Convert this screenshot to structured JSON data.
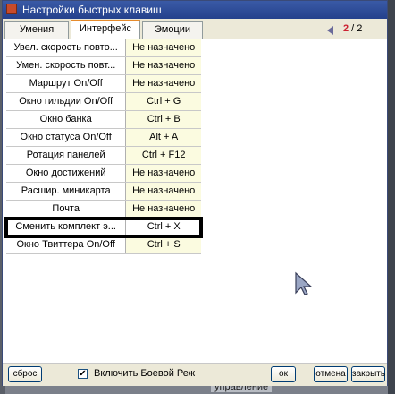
{
  "window": {
    "title": "Настройки быстрых клавиш"
  },
  "tabs": [
    {
      "label": "Умения",
      "active": false
    },
    {
      "label": "Интерфейс",
      "active": true
    },
    {
      "label": "Эмоции",
      "active": false
    }
  ],
  "pager": {
    "current": "2",
    "separator": " / ",
    "total": "2"
  },
  "rows": [
    {
      "name": "Увел. скорость повто...",
      "key": "Не назначено"
    },
    {
      "name": "Умен. скорость повт...",
      "key": "Не назначено"
    },
    {
      "name": "Маршрут On/Off",
      "key": "Не назначено"
    },
    {
      "name": "Окно гильдии On/Off",
      "key": "Ctrl + G"
    },
    {
      "name": "Окно банка",
      "key": "Ctrl + B"
    },
    {
      "name": "Окно статуса On/Off",
      "key": "Alt + A"
    },
    {
      "name": "Ротация панелей",
      "key": "Ctrl + F12"
    },
    {
      "name": "Окно достижений",
      "key": "Не назначено"
    },
    {
      "name": "Расшир. миникарта",
      "key": "Не назначено"
    },
    {
      "name": "Почта",
      "key": "Не назначено"
    },
    {
      "name": "Сменить комплект э...",
      "key": "Ctrl + X",
      "selected": true
    },
    {
      "name": "Окно Твиттера On/Off",
      "key": "Ctrl + S"
    }
  ],
  "footer": {
    "reset_label": "сброс",
    "checkbox_checked": true,
    "checkbox_label": "Включить Боевой Реж",
    "ok_label": "ок",
    "cancel_label": "отмена",
    "close_label": "закрыть"
  },
  "background": {
    "bottom_text": "управление"
  },
  "colors": {
    "titlebar": "#24418c",
    "active_tab_accent": "#e68b2c",
    "key_cell_bg": "#fbfbe0",
    "pager_current": "#cc2233"
  }
}
